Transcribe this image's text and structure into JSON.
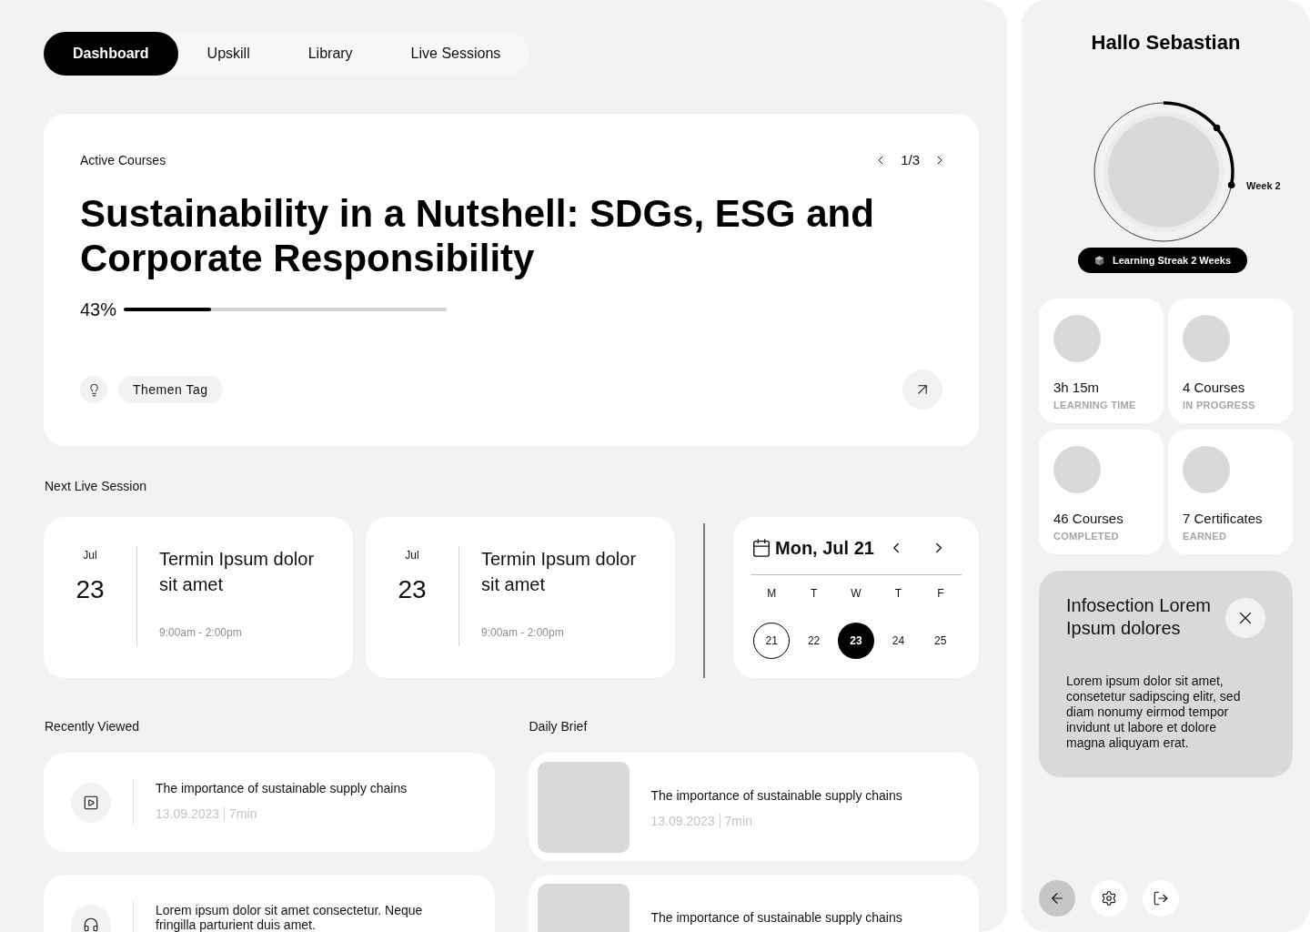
{
  "nav": {
    "tabs": [
      {
        "label": "Dashboard",
        "selected": true
      },
      {
        "label": "Upskill",
        "selected": false
      },
      {
        "label": "Library",
        "selected": false
      },
      {
        "label": "Live Sessions",
        "selected": false
      }
    ]
  },
  "active_course": {
    "heading": "Active Courses",
    "pager": "1/3",
    "title": "Sustainability in a Nutshell: SDGs, ESG and Corporate Responsibility",
    "progress": {
      "reading": "43%",
      "level": 0.27
    },
    "tag": "Themen Tag"
  },
  "next_live_session": {
    "heading": "Next Live Session",
    "sessions": [
      {
        "month": "Jul",
        "day": "23",
        "title": "Termin Ipsum dolor sit amet",
        "time": "9:00am - 2:00pm"
      },
      {
        "month": "Jul",
        "day": "23",
        "title": "Termin Ipsum dolor sit amet",
        "time": "9:00am - 2:00pm"
      }
    ]
  },
  "calendar": {
    "date": "Mon, Jul 21",
    "weekdays": [
      "M",
      "T",
      "W",
      "T",
      "F"
    ],
    "days": [
      {
        "label": "21",
        "today": true,
        "selected": false
      },
      {
        "label": "22",
        "today": false,
        "selected": false
      },
      {
        "label": "23",
        "today": false,
        "selected": true
      },
      {
        "label": "24",
        "today": false,
        "selected": false
      },
      {
        "label": "25",
        "today": false,
        "selected": false
      }
    ]
  },
  "recently_viewed": {
    "heading": "Recently Viewed",
    "items": [
      {
        "kind": "video",
        "title": "The importance of sustainable supply chains",
        "date": "13.09.2023",
        "duration": "7min"
      },
      {
        "kind": "audio",
        "title": "Lorem ipsum dolor sit amet consectetur. Neque fringilla parturient duis amet."
      }
    ]
  },
  "daily_brief": {
    "heading": "Daily Brief",
    "items": [
      {
        "title": "The importance of sustainable supply chains",
        "date": "13.09.2023",
        "duration": "7min"
      },
      {
        "title": "The importance of sustainable supply chains"
      }
    ]
  },
  "profile": {
    "greeting": "Hallo Sebastian",
    "streak": {
      "label": "Week 2"
    },
    "badge": "Learning Streak 2 Weeks"
  },
  "stats": [
    {
      "value": "3h 15m",
      "label": "LEARNING TIME"
    },
    {
      "value": "4 Courses",
      "label": "IN PROGRESS"
    },
    {
      "value": "46 Courses",
      "label": "COMPLETED"
    },
    {
      "value": "7 Certificates",
      "label": "EARNED"
    }
  ],
  "info": {
    "title": "Infosection Lorem Ipsum dolores",
    "text": "Lorem ipsum dolor sit amet, consetetur sadipscing elitr, sed diam nonumy eirmod tempor invidunt ut labore et dolore magna aliquyam erat."
  },
  "actions": [
    {
      "kind": "back",
      "selected": true
    },
    {
      "kind": "settings",
      "selected": false
    },
    {
      "kind": "logout",
      "selected": false
    }
  ]
}
